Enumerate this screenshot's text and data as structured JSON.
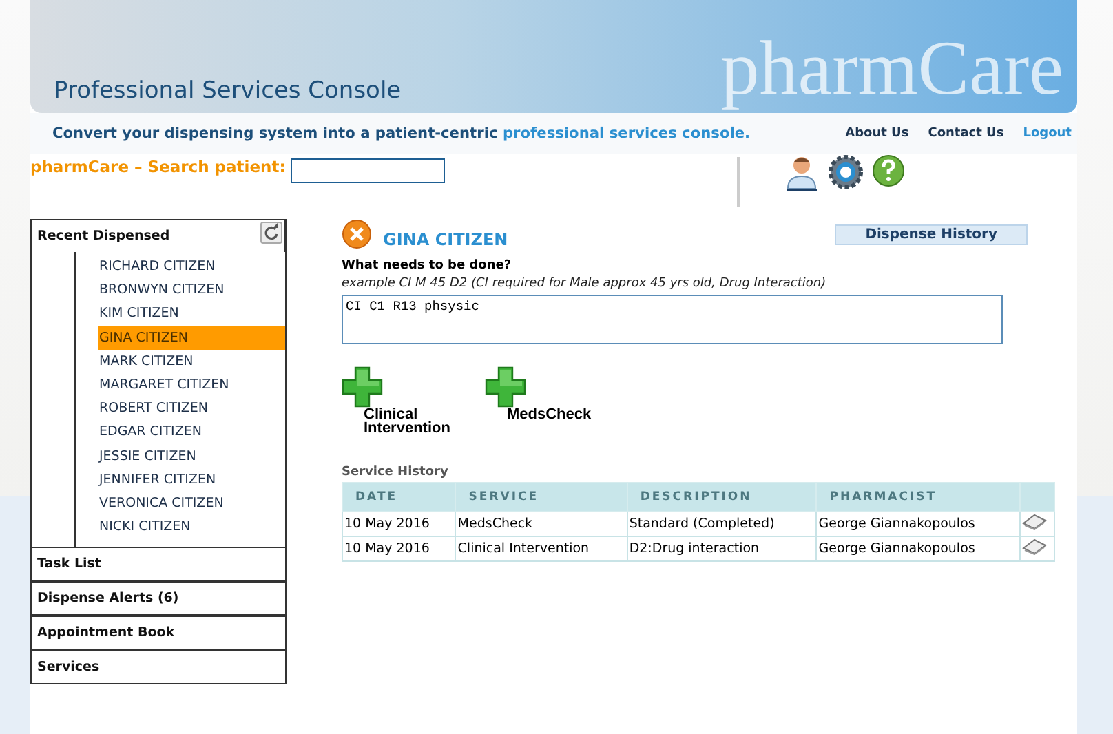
{
  "header": {
    "title": "Professional Services Console",
    "logo": "pharmCare"
  },
  "tagline": {
    "dark": "Convert your dispensing system into a patient-centric",
    "light": "professional services console."
  },
  "nav": [
    {
      "label": "About Us",
      "kind": "plain"
    },
    {
      "label": "Contact Us",
      "kind": "plain"
    },
    {
      "label": "Logout",
      "kind": "accent"
    }
  ],
  "search": {
    "label": "pharmCare – Search patient:"
  },
  "sidebar": {
    "recent_title": "Recent Dispensed",
    "patients": [
      {
        "name": "RICHARD CITIZEN",
        "selected": false
      },
      {
        "name": "BRONWYN CITIZEN",
        "selected": false
      },
      {
        "name": "KIM CITIZEN",
        "selected": false
      },
      {
        "name": "GINA CITIZEN",
        "selected": true
      },
      {
        "name": "MARK CITIZEN",
        "selected": false
      },
      {
        "name": "MARGARET CITIZEN",
        "selected": false
      },
      {
        "name": "ROBERT CITIZEN",
        "selected": false
      },
      {
        "name": "EDGAR CITIZEN",
        "selected": false
      },
      {
        "name": "JESSIE CITIZEN",
        "selected": false
      },
      {
        "name": "JENNIFER CITIZEN",
        "selected": false
      },
      {
        "name": "VERONICA CITIZEN",
        "selected": false
      },
      {
        "name": "NICKI CITIZEN",
        "selected": false
      }
    ],
    "sections": [
      "Task List",
      "Dispense Alerts (6)",
      "Appointment Book",
      "Services"
    ]
  },
  "patient": {
    "name": "GINA CITIZEN",
    "dispense_history": "Dispense History",
    "question": "What needs to be done?",
    "example": "example CI M 45 D2 (CI required for Male approx 45 yrs old, Drug Interaction)",
    "value": "CI C1 R13 phsysic"
  },
  "actions": [
    {
      "line1": "Clinical",
      "line2": "Intervention"
    },
    {
      "line1": "MedsCheck"
    }
  ],
  "service_history": {
    "title": "Service History",
    "columns": [
      "DATE",
      "SERVICE",
      "DESCRIPTION",
      "PHARMACIST"
    ],
    "rows": [
      [
        "10 May 2016",
        "MedsCheck",
        "Standard (Completed)",
        "George Giannakopoulos"
      ],
      [
        "10 May 2016",
        "Clinical Intervention",
        "D2:Drug interaction",
        "George Giannakopoulos"
      ]
    ]
  }
}
